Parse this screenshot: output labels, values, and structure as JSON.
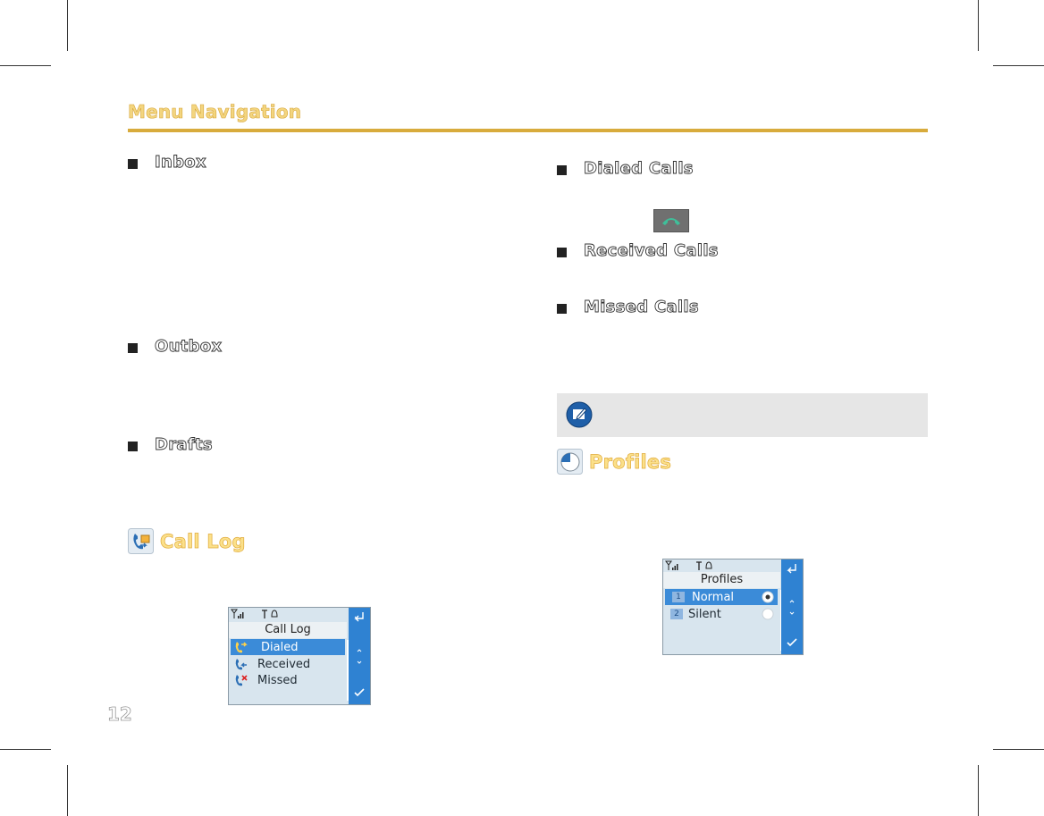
{
  "header": {
    "title": "Menu Navigation"
  },
  "left_column": {
    "bullets": [
      {
        "label": "Inbox"
      },
      {
        "label": "Outbox"
      },
      {
        "label": "Drafts"
      }
    ],
    "section": {
      "title": "Call Log"
    },
    "screen": {
      "title": "Call Log",
      "items": [
        {
          "label": "Dialed",
          "selected": true
        },
        {
          "label": "Received",
          "selected": false
        },
        {
          "label": "Missed",
          "selected": false
        }
      ]
    }
  },
  "right_column": {
    "bullets": [
      {
        "label": "Dialed Calls"
      },
      {
        "label": "Received Calls"
      },
      {
        "label": "Missed Calls"
      }
    ],
    "section": {
      "title": "Profiles"
    },
    "screen": {
      "title": "Profiles",
      "items": [
        {
          "number": "1",
          "label": "Normal",
          "selected": true
        },
        {
          "number": "2",
          "label": "Silent",
          "selected": false
        }
      ]
    }
  },
  "page_number": "12",
  "colors": {
    "title": "#f3d57f",
    "rule": "#d8ab3c",
    "highlight": "#3b8bd8",
    "sidebar": "#2f82d2"
  }
}
